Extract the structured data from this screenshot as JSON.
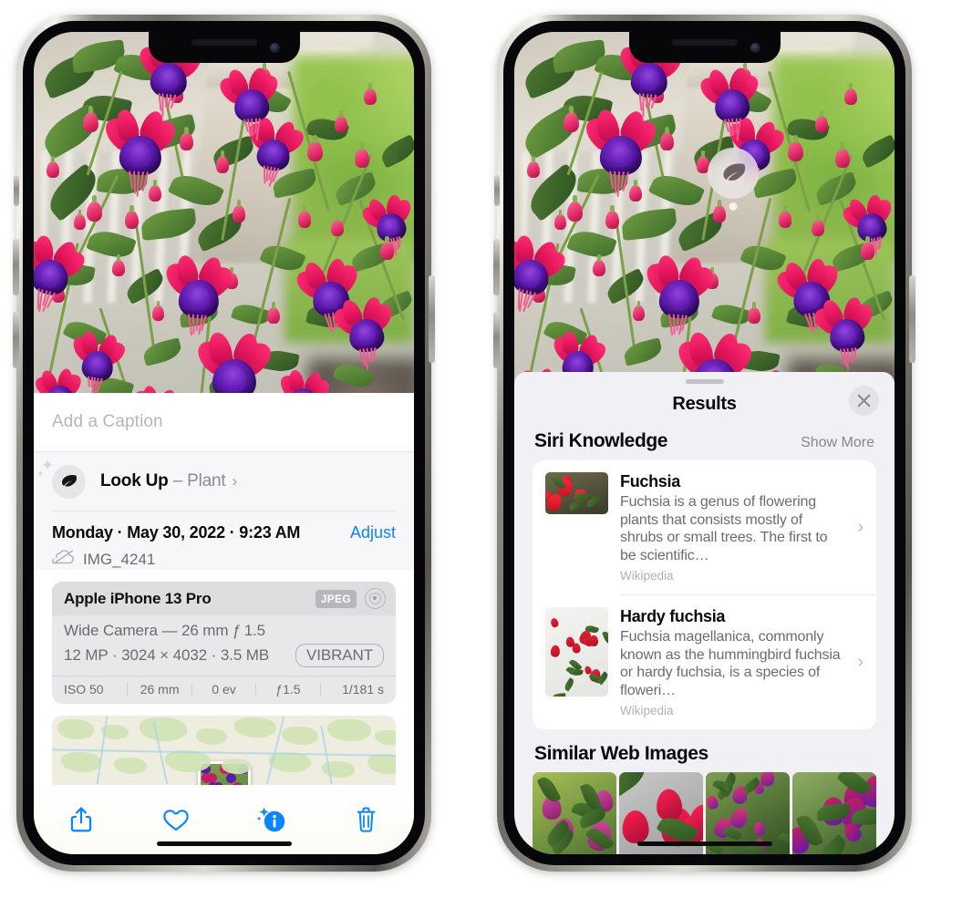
{
  "left_phone": {
    "caption": {
      "placeholder": "Add a Caption",
      "value": ""
    },
    "lookup": {
      "icon": "leaf-icon",
      "label": "Look Up",
      "dash": " – ",
      "subject": "Plant",
      "chevron": "›"
    },
    "metadata": {
      "date_line": "Monday · May 30, 2022 · 9:23 AM",
      "adjust_label": "Adjust",
      "cloud_icon": "icloud-slash-icon",
      "filename": "IMG_4241"
    },
    "camera_card": {
      "device": "Apple iPhone 13 Pro",
      "format_badge": "JPEG",
      "raw_icon": "raw-target-icon",
      "lens_line": "Wide Camera — 26 mm ƒ 1.5",
      "size_line": "12 MP · 3024 × 4032 · 3.5 MB",
      "profile_badge": "VIBRANT",
      "exif": [
        "ISO 50",
        "26 mm",
        "0 ev",
        "ƒ1.5",
        "1/181 s"
      ]
    },
    "toolbar": [
      {
        "name": "share-button",
        "icon": "share-icon"
      },
      {
        "name": "favorite-button",
        "icon": "heart-icon"
      },
      {
        "name": "info-button",
        "icon": "info-sparkle-icon"
      },
      {
        "name": "delete-button",
        "icon": "trash-icon"
      }
    ]
  },
  "right_phone": {
    "photo_badge": {
      "icon": "leaf-icon",
      "name": "visual-lookup-badge"
    },
    "sheet": {
      "title": "Results",
      "close_icon": "close-icon"
    },
    "siri_knowledge": {
      "section_title": "Siri Knowledge",
      "show_more": "Show More",
      "items": [
        {
          "title": "Fuchsia",
          "description": "Fuchsia is a genus of flowering plants that consists mostly of shrubs or small trees. The first to be scientific…",
          "source": "Wikipedia",
          "thumb": "fuchsia-red-flowers-thumbnail"
        },
        {
          "title": "Hardy fuchsia",
          "description": "Fuchsia magellanica, commonly known as the hummingbird fuchsia or hardy fuchsia, is a species of floweri…",
          "source": "Wikipedia",
          "thumb": "hardy-fuchsia-specimen-thumbnail"
        }
      ]
    },
    "similar_web_images": {
      "section_title": "Similar Web Images",
      "items": [
        {
          "name": "web-image-1",
          "alt": "pink white fuchsia with green leaves"
        },
        {
          "name": "web-image-2",
          "alt": "red fuchsia closeup on gray"
        },
        {
          "name": "web-image-3",
          "alt": "fuchsia bush with buds"
        },
        {
          "name": "web-image-4",
          "alt": "purple and red fuchsia cluster"
        }
      ]
    }
  },
  "colors": {
    "accent_blue": "#0A84FF",
    "panel_gray": "#F1F1F5",
    "card_white": "#FFFFFF",
    "secondary_text": "#6C6C70",
    "tertiary_text": "#B0B0B6"
  }
}
